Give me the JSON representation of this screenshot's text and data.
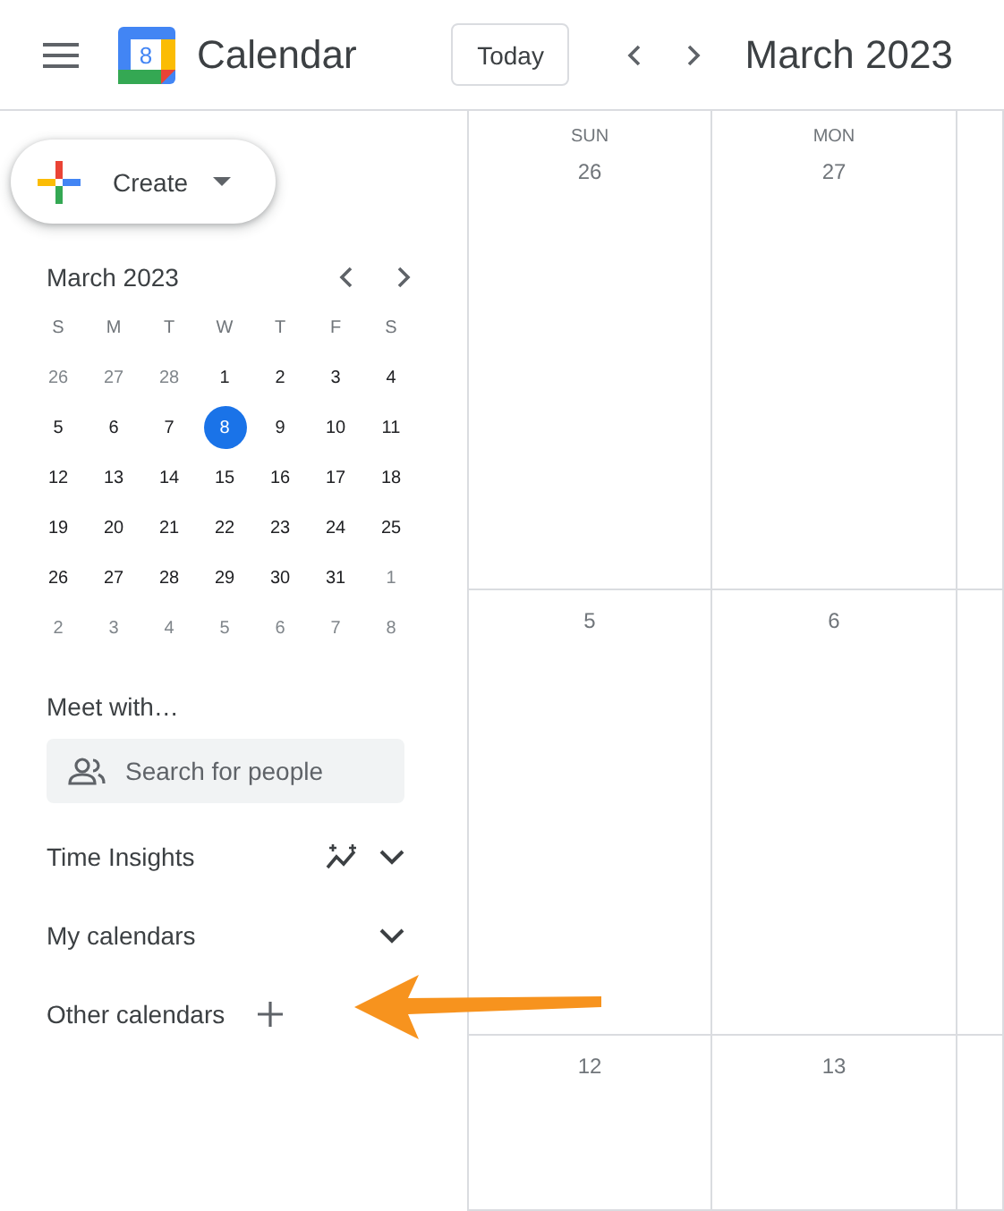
{
  "header": {
    "app_name": "Calendar",
    "logo_digit": "8",
    "today_button": "Today",
    "period": "March 2023"
  },
  "create_button": {
    "label": "Create"
  },
  "mini_calendar": {
    "title": "March 2023",
    "weekdays": [
      "S",
      "M",
      "T",
      "W",
      "T",
      "F",
      "S"
    ],
    "days": [
      {
        "label": "26",
        "muted": true,
        "selected": false
      },
      {
        "label": "27",
        "muted": true,
        "selected": false
      },
      {
        "label": "28",
        "muted": true,
        "selected": false
      },
      {
        "label": "1",
        "muted": false,
        "selected": false
      },
      {
        "label": "2",
        "muted": false,
        "selected": false
      },
      {
        "label": "3",
        "muted": false,
        "selected": false
      },
      {
        "label": "4",
        "muted": false,
        "selected": false
      },
      {
        "label": "5",
        "muted": false,
        "selected": false
      },
      {
        "label": "6",
        "muted": false,
        "selected": false
      },
      {
        "label": "7",
        "muted": false,
        "selected": false
      },
      {
        "label": "8",
        "muted": false,
        "selected": true
      },
      {
        "label": "9",
        "muted": false,
        "selected": false
      },
      {
        "label": "10",
        "muted": false,
        "selected": false
      },
      {
        "label": "11",
        "muted": false,
        "selected": false
      },
      {
        "label": "12",
        "muted": false,
        "selected": false
      },
      {
        "label": "13",
        "muted": false,
        "selected": false
      },
      {
        "label": "14",
        "muted": false,
        "selected": false
      },
      {
        "label": "15",
        "muted": false,
        "selected": false
      },
      {
        "label": "16",
        "muted": false,
        "selected": false
      },
      {
        "label": "17",
        "muted": false,
        "selected": false
      },
      {
        "label": "18",
        "muted": false,
        "selected": false
      },
      {
        "label": "19",
        "muted": false,
        "selected": false
      },
      {
        "label": "20",
        "muted": false,
        "selected": false
      },
      {
        "label": "21",
        "muted": false,
        "selected": false
      },
      {
        "label": "22",
        "muted": false,
        "selected": false
      },
      {
        "label": "23",
        "muted": false,
        "selected": false
      },
      {
        "label": "24",
        "muted": false,
        "selected": false
      },
      {
        "label": "25",
        "muted": false,
        "selected": false
      },
      {
        "label": "26",
        "muted": false,
        "selected": false
      },
      {
        "label": "27",
        "muted": false,
        "selected": false
      },
      {
        "label": "28",
        "muted": false,
        "selected": false
      },
      {
        "label": "29",
        "muted": false,
        "selected": false
      },
      {
        "label": "30",
        "muted": false,
        "selected": false
      },
      {
        "label": "31",
        "muted": false,
        "selected": false
      },
      {
        "label": "1",
        "muted": true,
        "selected": false
      },
      {
        "label": "2",
        "muted": true,
        "selected": false
      },
      {
        "label": "3",
        "muted": true,
        "selected": false
      },
      {
        "label": "4",
        "muted": true,
        "selected": false
      },
      {
        "label": "5",
        "muted": true,
        "selected": false
      },
      {
        "label": "6",
        "muted": true,
        "selected": false
      },
      {
        "label": "7",
        "muted": true,
        "selected": false
      },
      {
        "label": "8",
        "muted": true,
        "selected": false
      }
    ]
  },
  "meet_with": {
    "title": "Meet with…",
    "placeholder": "Search for people"
  },
  "sections": [
    {
      "label": "Time Insights",
      "kind": "insights"
    },
    {
      "label": "My calendars",
      "kind": "collapsible"
    },
    {
      "label": "Other calendars",
      "kind": "addable"
    }
  ],
  "month_grid": {
    "weekdays": [
      "SUN",
      "MON"
    ],
    "rows": [
      [
        "26",
        "27"
      ],
      [
        "5",
        "6"
      ],
      [
        "12",
        "13"
      ]
    ]
  }
}
